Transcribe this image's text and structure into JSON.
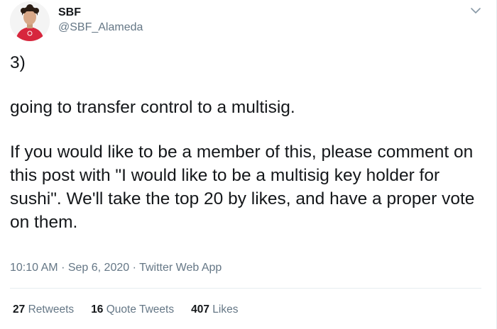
{
  "author": {
    "display_name": "SBF",
    "handle": "@SBF_Alameda",
    "avatar_icon": "profile-avatar"
  },
  "menu": {
    "icon": "chevron-down-icon"
  },
  "tweet": {
    "paragraphs": [
      "3)",
      "going to transfer control to a multisig.",
      "If you would like to be a member of this, please comment on this post with \"I would like to be a multisig key holder for sushi\".  We'll take the top 20 by likes, and have a proper vote on them."
    ]
  },
  "meta": {
    "time": "10:10 AM",
    "separator": "·",
    "date": "Sep 6, 2020",
    "source": "Twitter Web App"
  },
  "stats": {
    "retweets": {
      "count": "27",
      "label": "Retweets"
    },
    "quote_tweets": {
      "count": "16",
      "label": "Quote Tweets"
    },
    "likes": {
      "count": "407",
      "label": "Likes"
    }
  },
  "colors": {
    "text": "#14171a",
    "secondary": "#657786",
    "divider": "#e6ecf0",
    "avatar_shirt": "#d7263d"
  }
}
